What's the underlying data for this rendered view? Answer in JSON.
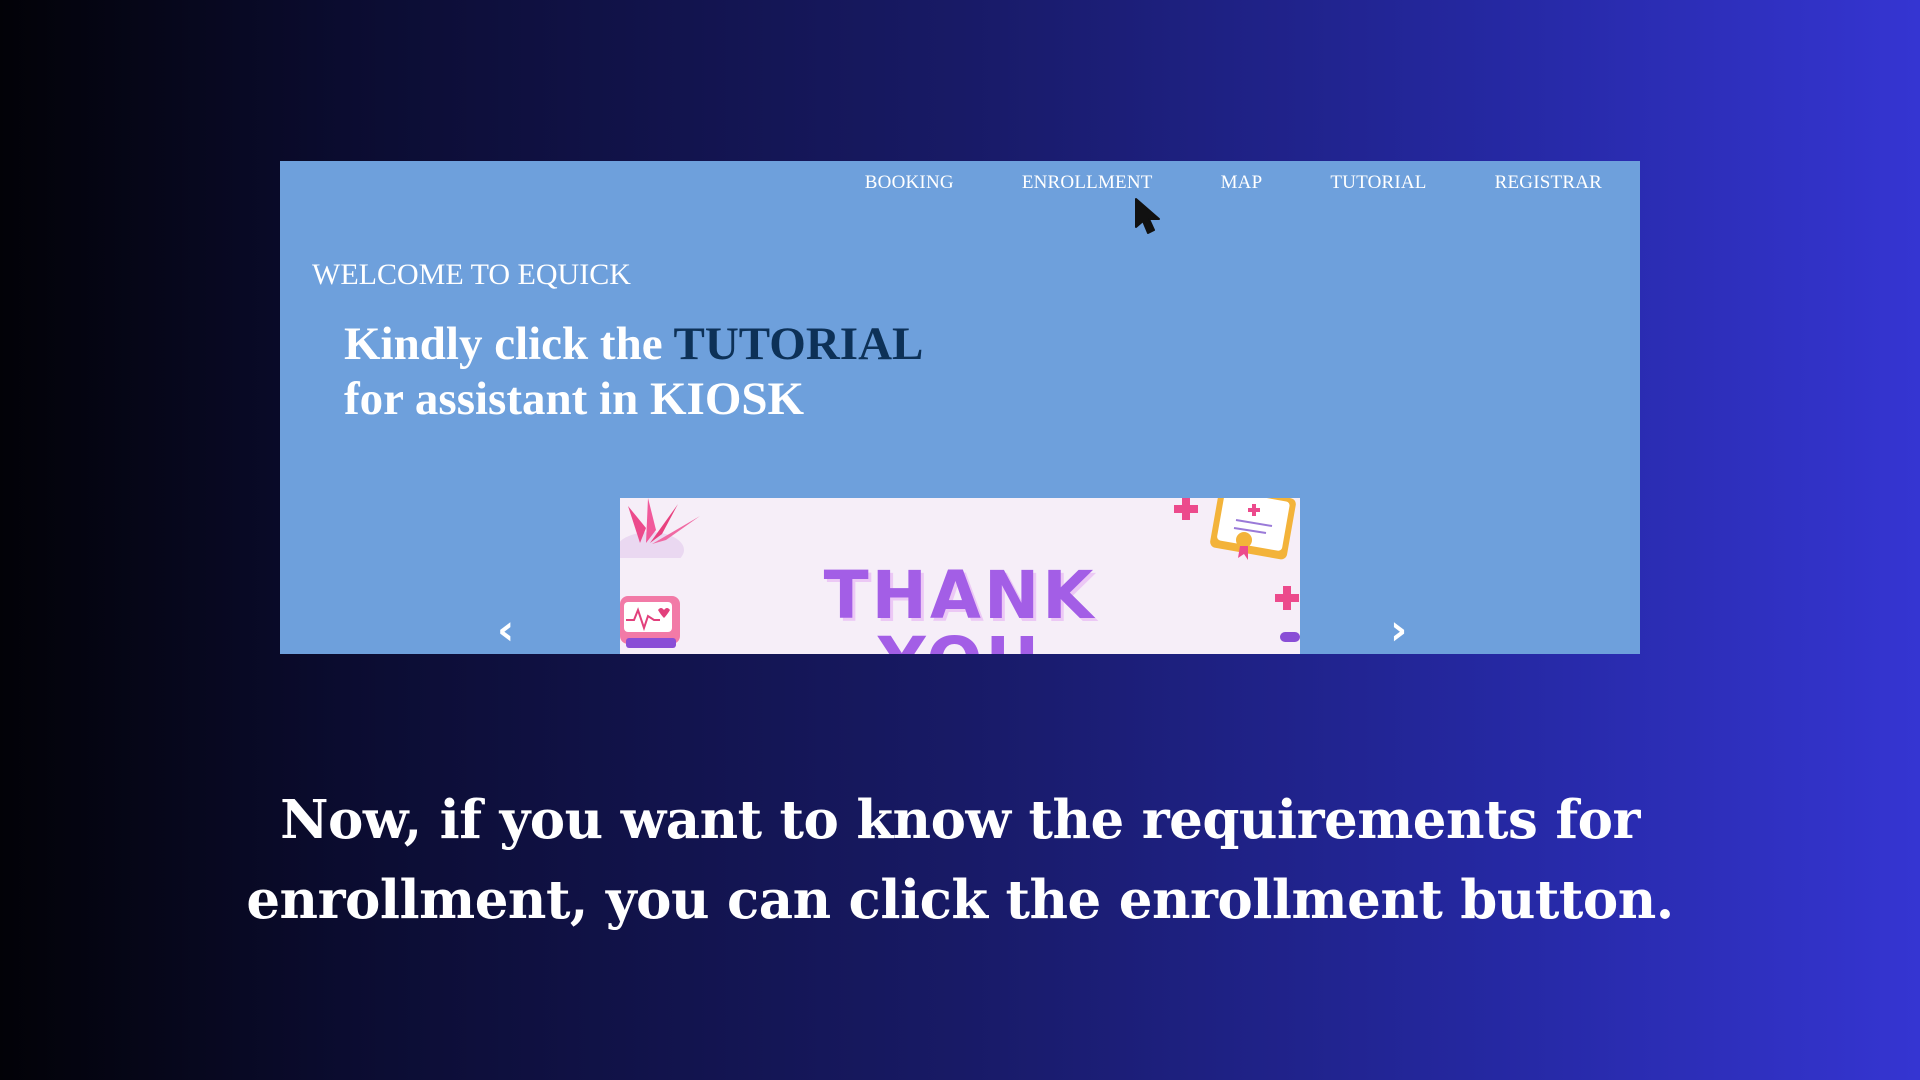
{
  "site": {
    "nav": {
      "booking": "BOOKING",
      "enrollment": "ENROLLMENT",
      "map": "MAP",
      "tutorial": "TUTORIAL",
      "registrar": "REGISTRAR"
    },
    "welcome": "WELCOME TO EQUICK",
    "headline": {
      "part1": "Kindly click the ",
      "accent": "TUTORIAL",
      "line2": "for assistant in KIOSK"
    },
    "carousel": {
      "prev_icon": "‹",
      "next_icon": "›",
      "slide_title": "THANK",
      "slide_sub": "YOU"
    }
  },
  "caption": {
    "line1": "Now, if you want to know the requirements for",
    "line2": "enrollment, you can click the enrollment button."
  },
  "colors": {
    "site_background": "#6ea0dc",
    "accent_text": "#0d3157",
    "slide_text": "#a35ee6"
  }
}
